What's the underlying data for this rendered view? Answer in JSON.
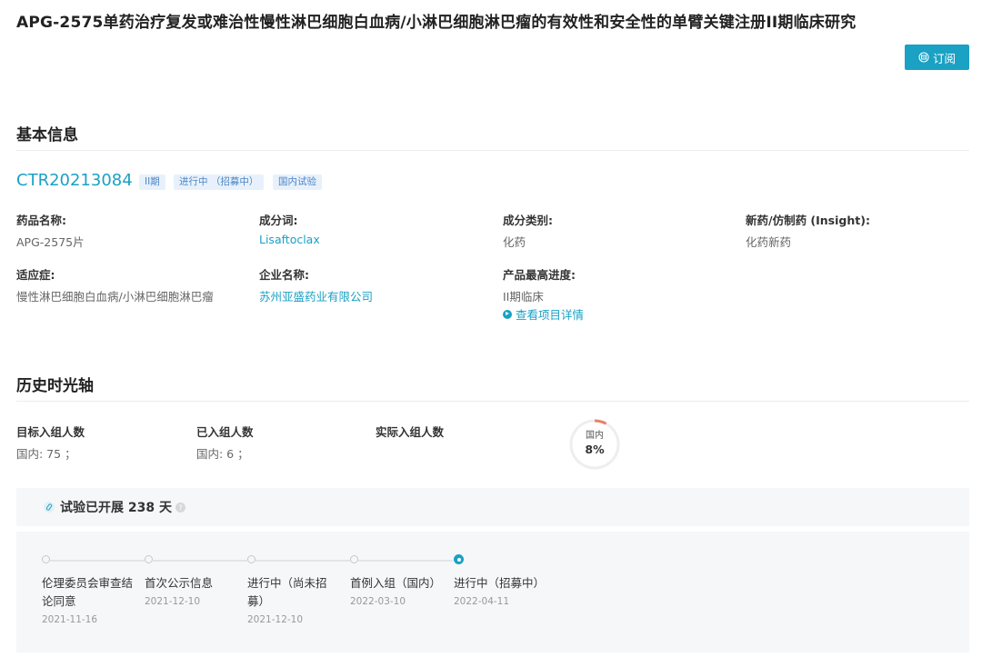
{
  "page": {
    "title": "APG-2575单药治疗复发或难治性慢性淋巴细胞白血病/小淋巴细胞淋巴瘤的有效性和安全性的单臂关键注册II期临床研究",
    "subscribe_label": "订阅"
  },
  "basic_info": {
    "section_title": "基本信息",
    "trial_id": "CTR20213084",
    "tags": [
      "II期",
      "进行中 （招募中）",
      "国内试验"
    ],
    "fields": {
      "drug_name": {
        "label": "药品名称:",
        "value": "APG-2575片"
      },
      "ingredient": {
        "label": "成分词:",
        "value": "Lisaftoclax"
      },
      "ingredient_type": {
        "label": "成分类别:",
        "value": "化药"
      },
      "new_or_generic": {
        "label": "新药/仿制药 (Insight):",
        "value": "化药新药"
      },
      "indication": {
        "label": "适应症:",
        "value": "慢性淋巴细胞白血病/小淋巴细胞淋巴瘤"
      },
      "company": {
        "label": "企业名称:",
        "value": "苏州亚盛药业有限公司"
      },
      "max_progress": {
        "label": "产品最高进度:",
        "value": "II期临床"
      }
    },
    "project_detail_link": "查看项目详情"
  },
  "timeline": {
    "section_title": "历史时光轴",
    "enrollment": {
      "target": {
        "label": "目标入组人数",
        "value": "国内: 75 ；"
      },
      "enrolled": {
        "label": "已入组人数",
        "value": "国内: 6 ；"
      },
      "actual": {
        "label": "实际入组人数"
      }
    },
    "donut": {
      "label": "国内",
      "percent_text": "8%",
      "percent": 8,
      "color": "#e8826a"
    },
    "duration_text": "试验已开展 238 天",
    "events": [
      {
        "label": "伦理委员会审查结论同意",
        "date": "2021-11-16",
        "active": false
      },
      {
        "label": "首次公示信息",
        "date": "2021-12-10",
        "active": false
      },
      {
        "label": "进行中（尚未招募）",
        "date": "2021-12-10",
        "active": false
      },
      {
        "label": "首例入组（国内）",
        "date": "2022-03-10",
        "active": false
      },
      {
        "label": "进行中（招募中）",
        "date": "2022-04-11",
        "active": true
      }
    ]
  }
}
